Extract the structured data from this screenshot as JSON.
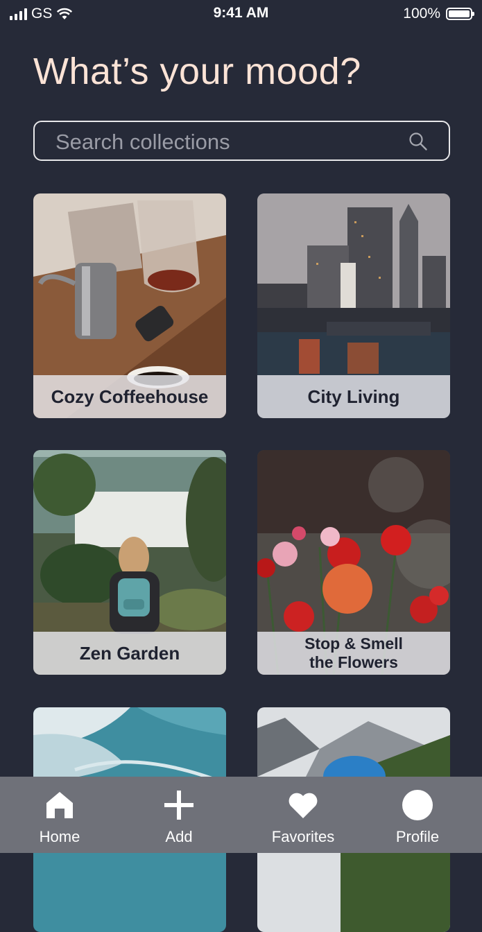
{
  "status": {
    "carrier": "GS",
    "time": "9:41 AM",
    "battery": "100%"
  },
  "title": "What’s your mood?",
  "search": {
    "placeholder": "Search collections"
  },
  "collections": [
    {
      "label": "Cozy Coffeehouse"
    },
    {
      "label": "City Living"
    },
    {
      "label": "Zen Garden"
    },
    {
      "label": "Stop & Smell the Flowers",
      "line1": "Stop & Smell",
      "line2": "the Flowers"
    },
    {
      "label": ""
    },
    {
      "label": ""
    }
  ],
  "tabs": [
    {
      "label": "Home",
      "icon": "home-icon"
    },
    {
      "label": "Add",
      "icon": "plus-icon"
    },
    {
      "label": "Favorites",
      "icon": "heart-icon"
    },
    {
      "label": "Profile",
      "icon": "profile-icon"
    }
  ],
  "colors": {
    "background": "#262a38",
    "title": "#fbe3d6",
    "tabbar": "#6f7179"
  }
}
